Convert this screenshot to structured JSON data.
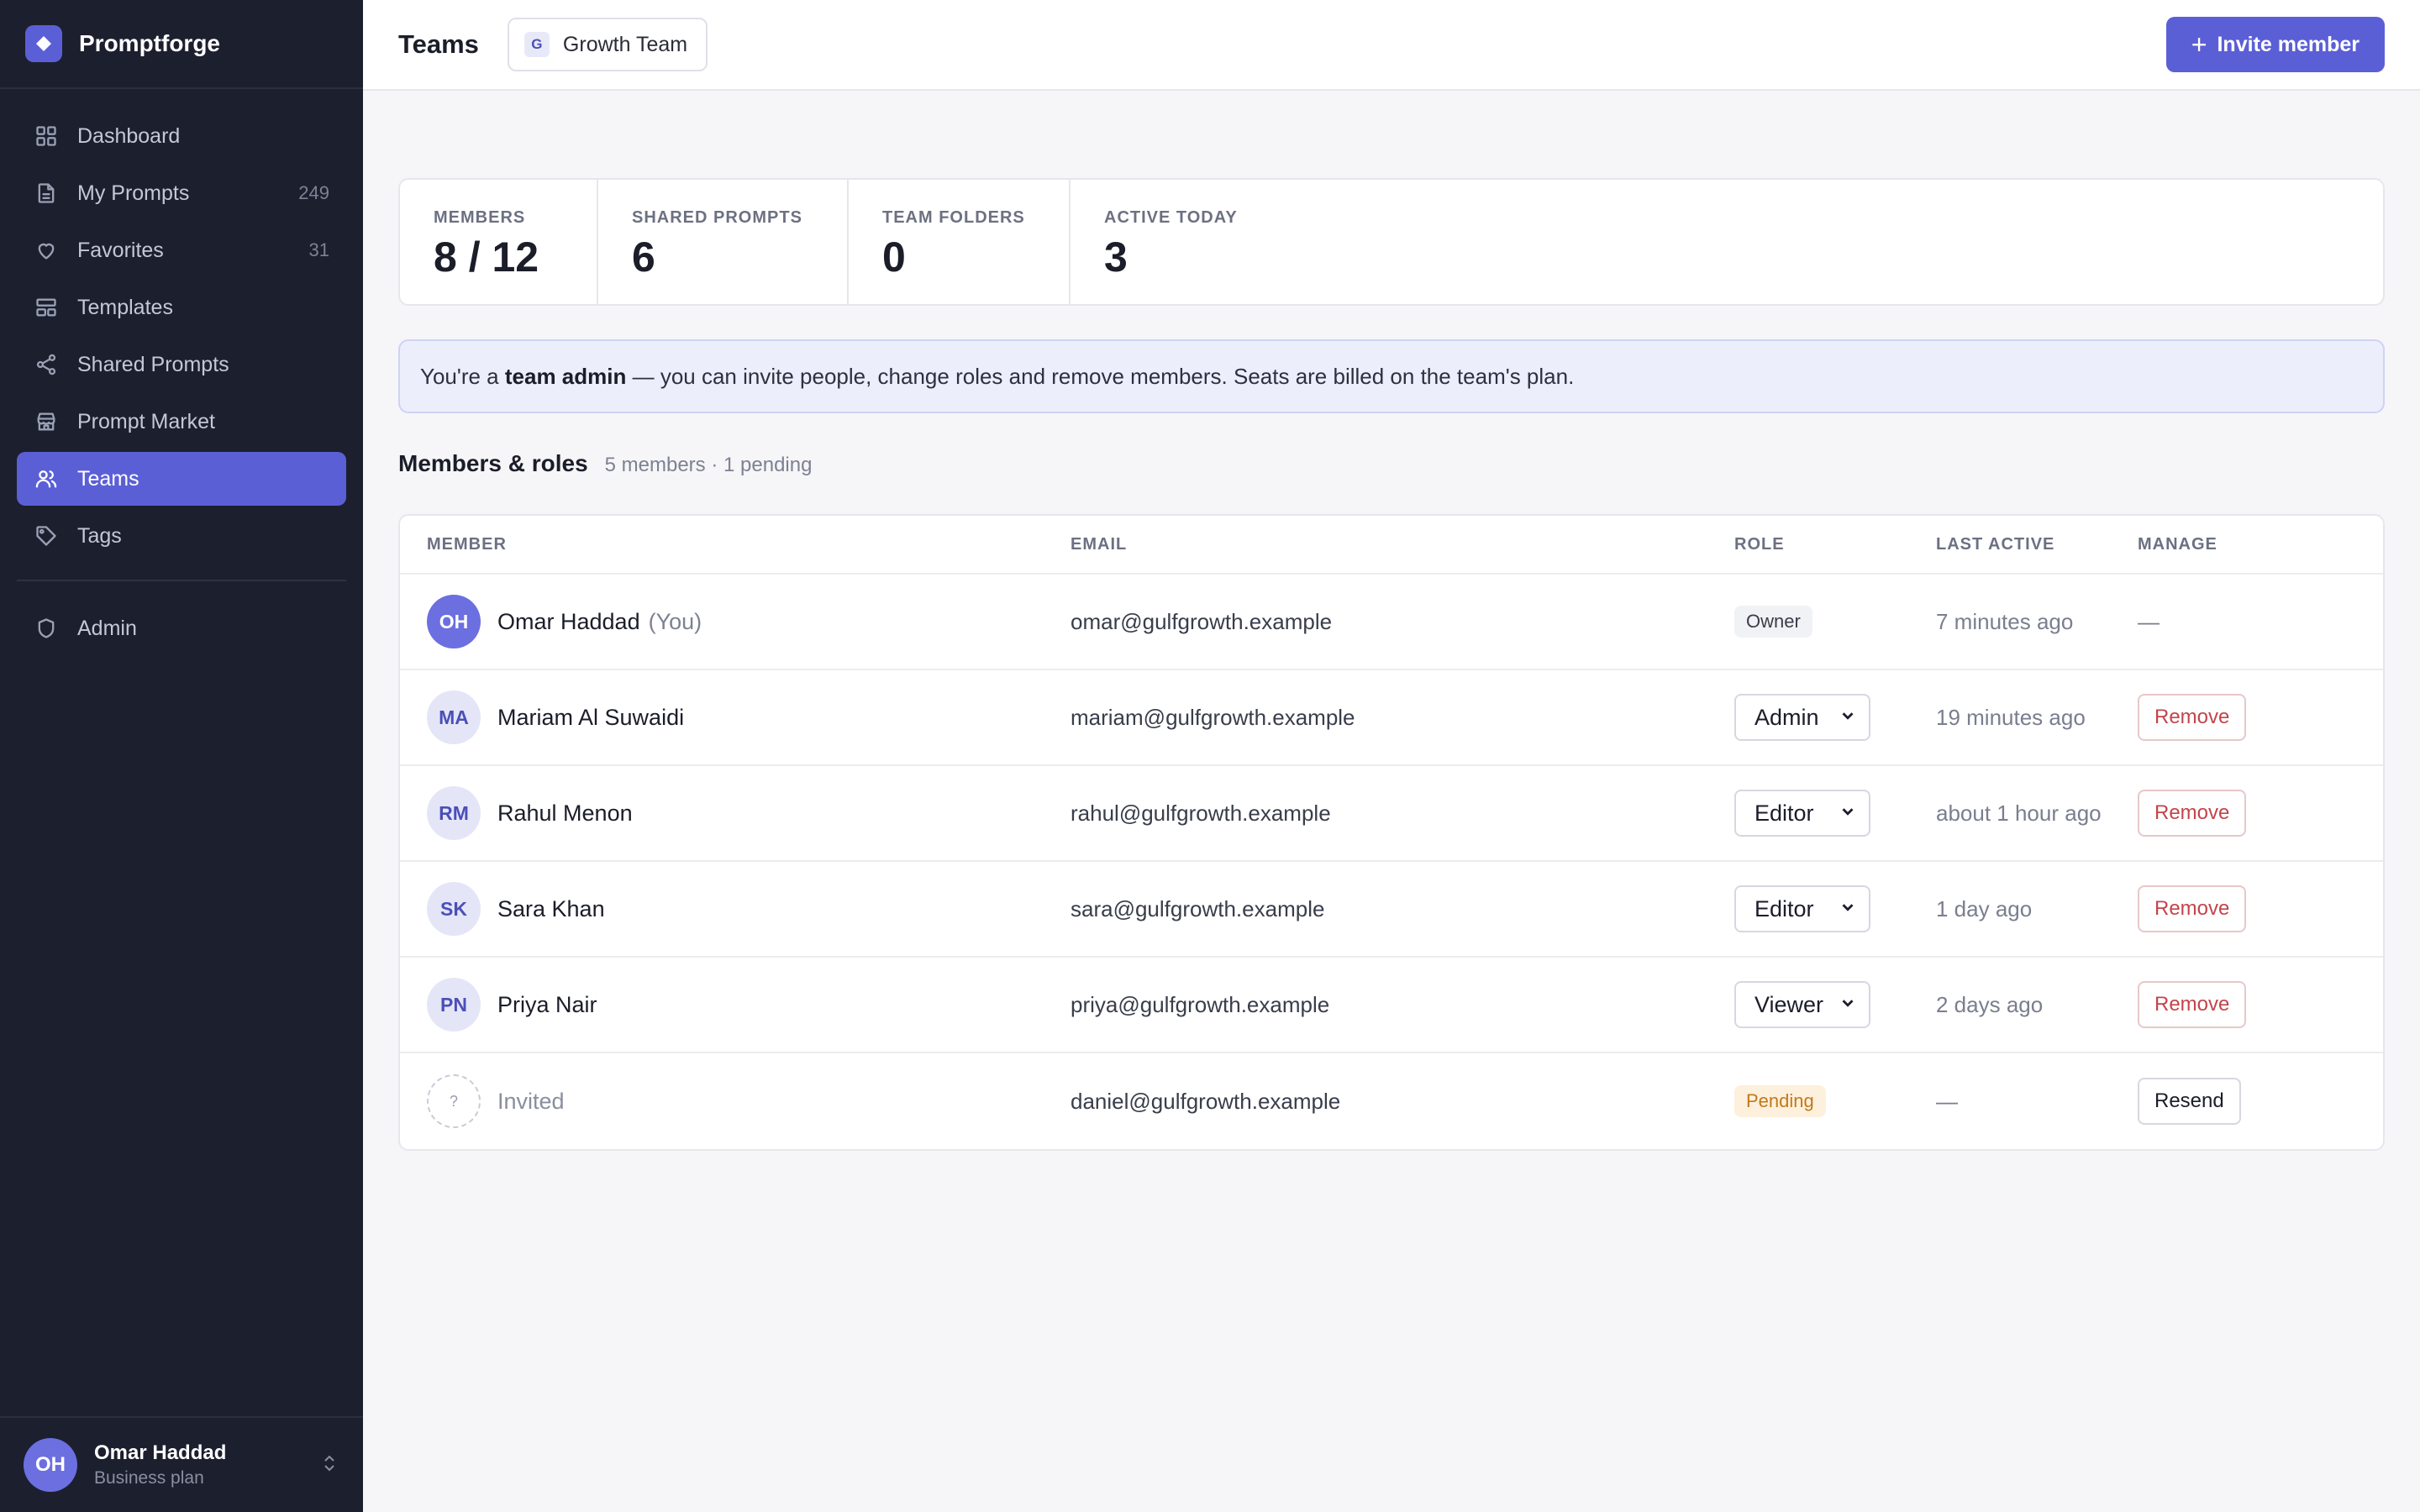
{
  "brand": {
    "name": "Promptforge",
    "logo_icon": "diamond-logo-icon",
    "accent": "#5b5fd6"
  },
  "sidebar": {
    "items": [
      {
        "label": "Dashboard",
        "icon": "grid-icon",
        "count": ""
      },
      {
        "label": "My Prompts",
        "icon": "document-icon",
        "count": "249"
      },
      {
        "label": "Favorites",
        "icon": "heart-icon",
        "count": "31"
      },
      {
        "label": "Templates",
        "icon": "template-icon",
        "count": ""
      },
      {
        "label": "Shared Prompts",
        "icon": "share-icon",
        "count": ""
      },
      {
        "label": "Prompt Market",
        "icon": "store-icon",
        "count": ""
      },
      {
        "label": "Teams",
        "icon": "users-icon",
        "count": "",
        "active": true
      },
      {
        "label": "Tags",
        "icon": "tag-icon",
        "count": ""
      }
    ],
    "admin": {
      "label": "Admin",
      "icon": "shield-icon"
    },
    "user": {
      "initials": "OH",
      "name": "Omar Haddad",
      "plan": "Business plan"
    }
  },
  "header": {
    "title": "Teams",
    "team": {
      "badge": "G",
      "name": "Growth Team"
    },
    "invite_plus": "+",
    "invite_label": "Invite member"
  },
  "stats": [
    {
      "label": "MEMBERS",
      "value": "8 / 12"
    },
    {
      "label": "SHARED PROMPTS",
      "value": "6"
    },
    {
      "label": "TEAM FOLDERS",
      "value": "0"
    },
    {
      "label": "ACTIVE TODAY",
      "value": "3"
    }
  ],
  "notice": {
    "prefix": "You're a ",
    "emphasis": "team admin",
    "suffix": " — you can invite people, change roles and remove members. Seats are billed on the team's plan."
  },
  "members_section": {
    "title": "Members & roles",
    "subtitle": "5 members · 1 pending",
    "columns": {
      "member": "MEMBER",
      "email": "EMAIL",
      "role": "ROLE",
      "last_active": "LAST ACTIVE",
      "manage": "MANAGE"
    },
    "rows": [
      {
        "initials": "OH",
        "name": "Omar Haddad",
        "you": "(You)",
        "email": "omar@gulfgrowth.example",
        "role": "Owner",
        "last_active": "7 minutes ago",
        "manage": "—"
      },
      {
        "initials": "MA",
        "name": "Mariam Al Suwaidi",
        "email": "mariam@gulfgrowth.example",
        "role": "Admin",
        "last_active": "19 minutes ago",
        "manage": "Remove"
      },
      {
        "initials": "RM",
        "name": "Rahul Menon",
        "email": "rahul@gulfgrowth.example",
        "role": "Editor",
        "last_active": "about 1 hour ago",
        "manage": "Remove"
      },
      {
        "initials": "SK",
        "name": "Sara Khan",
        "email": "sara@gulfgrowth.example",
        "role": "Editor",
        "last_active": "1 day ago",
        "manage": "Remove"
      },
      {
        "initials": "PN",
        "name": "Priya Nair",
        "email": "priya@gulfgrowth.example",
        "role": "Viewer",
        "last_active": "2 days ago",
        "manage": "Remove"
      },
      {
        "initials": "?",
        "name": "Invited",
        "email": "daniel@gulfgrowth.example",
        "role": "Pending",
        "last_active": "—",
        "manage": "Resend"
      }
    ]
  }
}
